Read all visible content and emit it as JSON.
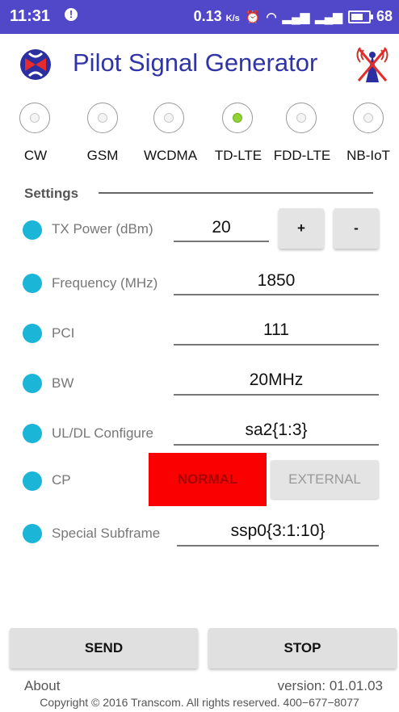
{
  "status_bar": {
    "time": "11:31",
    "speed": "0.13",
    "speed_unit": "K/s",
    "battery": "68",
    "battery_level_percent": 68
  },
  "header": {
    "title": "Pilot Signal Generator"
  },
  "modes": [
    {
      "label": "CW",
      "selected": false
    },
    {
      "label": "GSM",
      "selected": false
    },
    {
      "label": "WCDMA",
      "selected": false
    },
    {
      "label": "TD-LTE",
      "selected": true
    },
    {
      "label": "FDD-LTE",
      "selected": false
    },
    {
      "label": "NB-IoT",
      "selected": false
    }
  ],
  "settings": {
    "section_title": "Settings",
    "tx_power": {
      "label": "TX Power (dBm)",
      "value": "20",
      "plus": "+",
      "minus": "-"
    },
    "frequency": {
      "label": "Frequency (MHz)",
      "value": "1850"
    },
    "pci": {
      "label": "PCI",
      "value": "111"
    },
    "bw": {
      "label": "BW",
      "value": "20MHz"
    },
    "ul_dl": {
      "label": "UL/DL Configure",
      "value": "sa2{1:3}"
    },
    "cp": {
      "label": "CP",
      "normal": "NORMAL",
      "external": "EXTERNAL",
      "selected": "NORMAL"
    },
    "special_subframe": {
      "label": "Special Subframe",
      "value": "ssp0{3:1:10}"
    }
  },
  "actions": {
    "send": "SEND",
    "stop": "STOP"
  },
  "footer": {
    "about": "About",
    "version": "version: 01.01.03",
    "copyright": "Copyright © 2016 Transcom. All rights reserved. 400−677−8077"
  },
  "colors": {
    "status_bar": "#5147c9",
    "title": "#3034a6",
    "bullet": "#1bb5d8",
    "radio_selected": "#8fd336",
    "cp_normal": "#fb0000"
  }
}
